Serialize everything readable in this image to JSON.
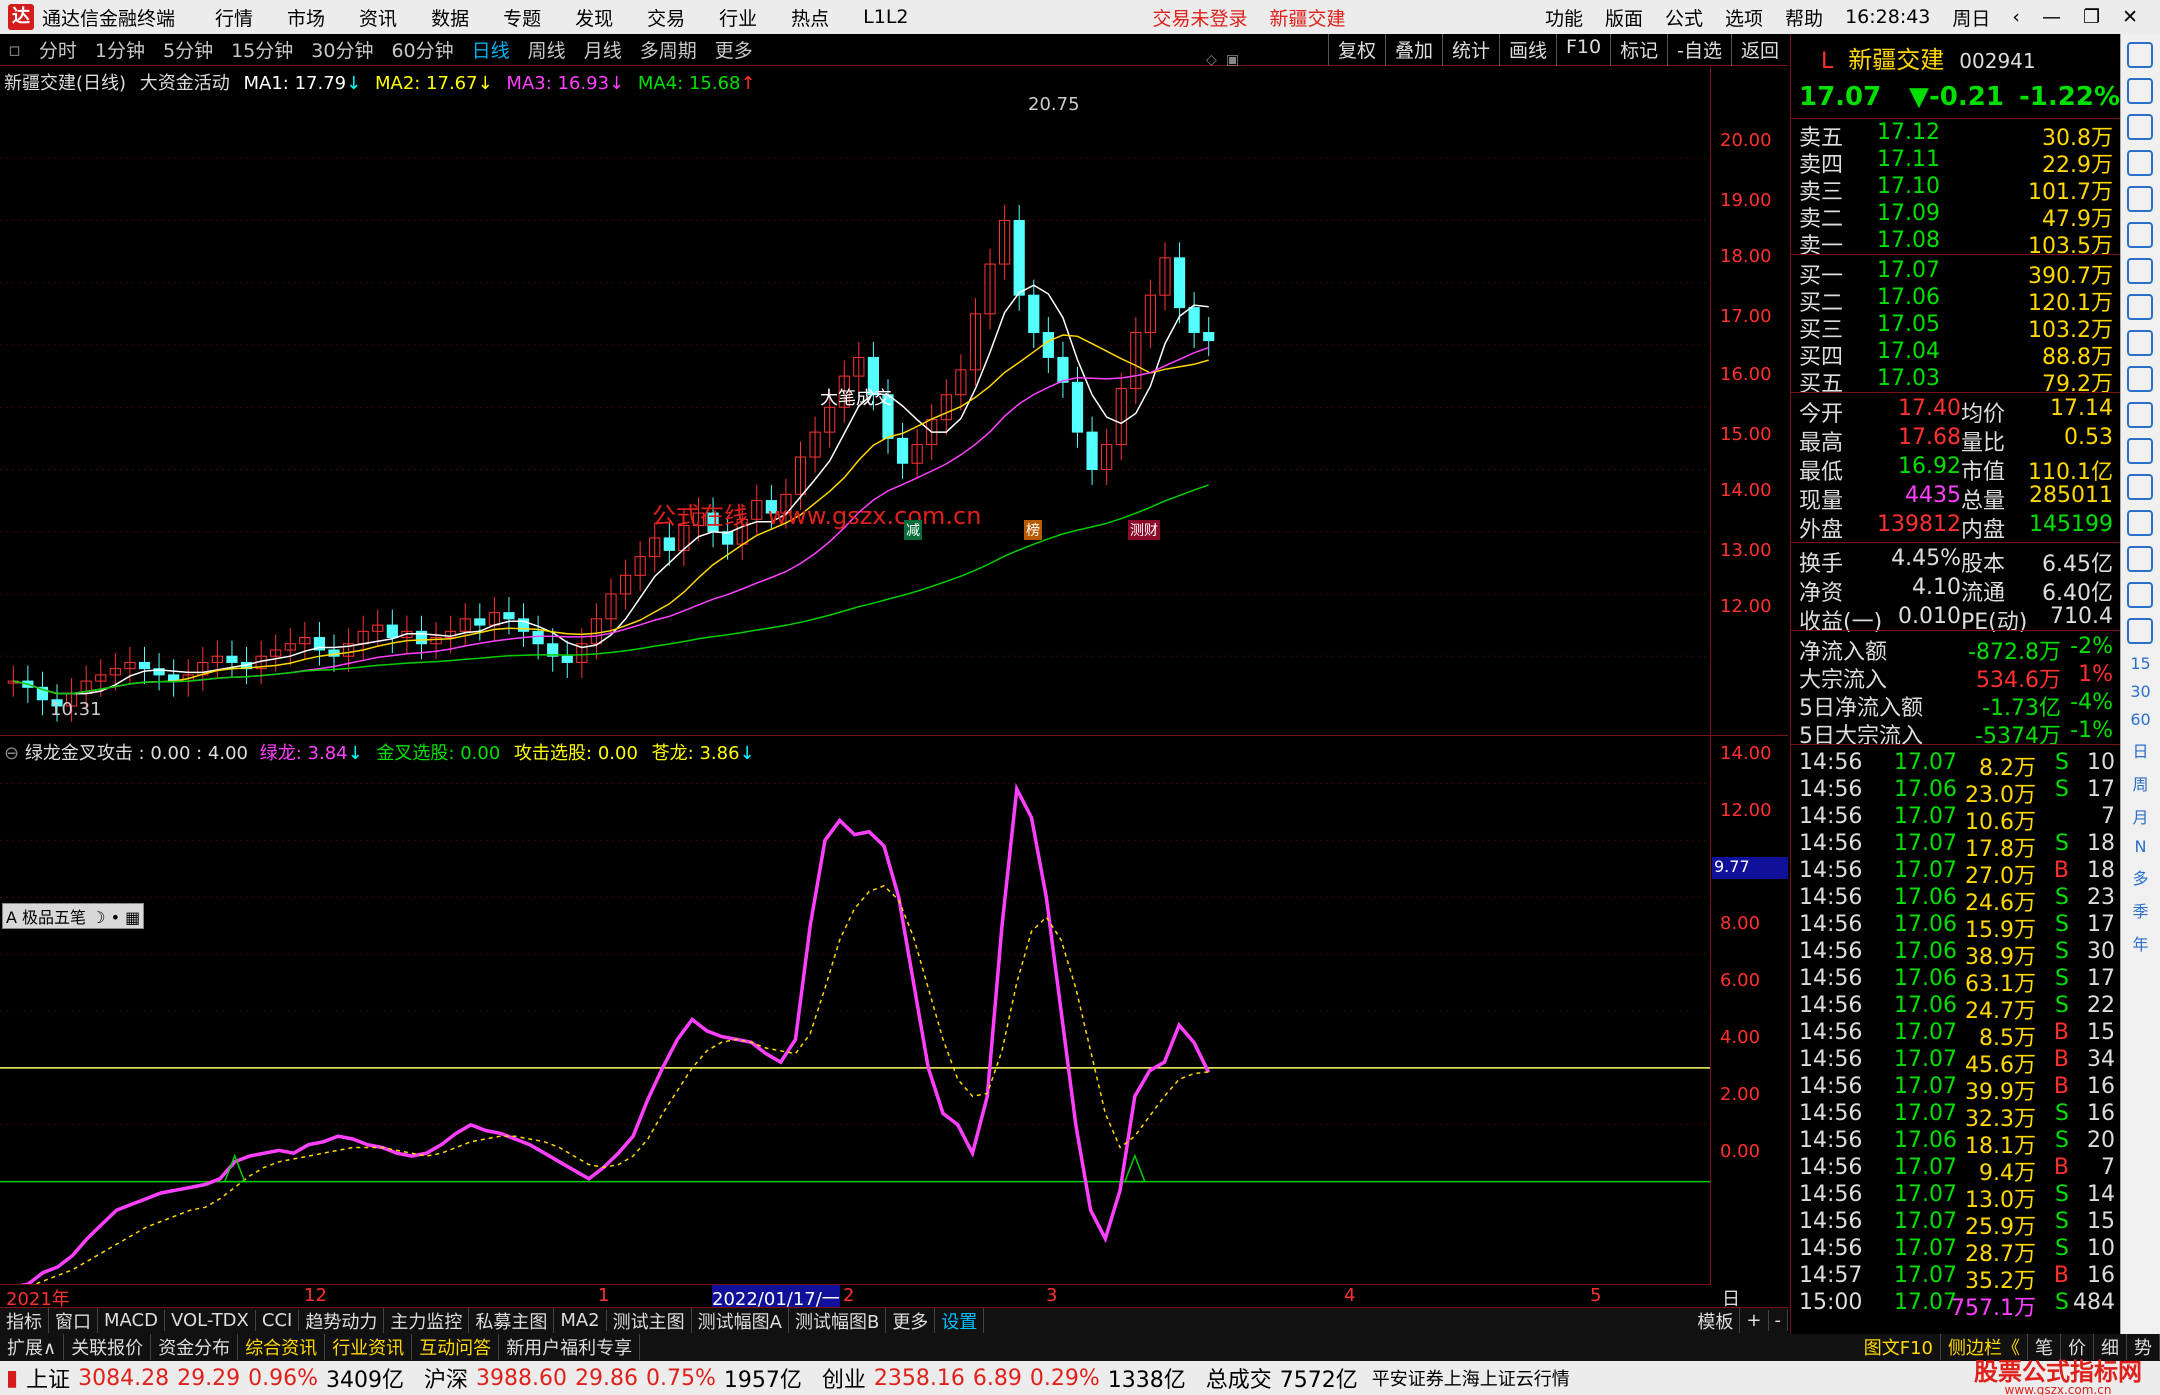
{
  "menubar": {
    "app_title": "通达信金融终端",
    "items": [
      "行情",
      "市场",
      "资讯",
      "数据",
      "专题",
      "发现",
      "交易",
      "行业",
      "热点",
      "L1L2"
    ],
    "warn1": "交易未登录",
    "warn2": "新疆交建",
    "right": [
      "功能",
      "版面",
      "公式",
      "选项",
      "帮助"
    ],
    "time": "16:28:43",
    "weekday": "周日"
  },
  "periods": [
    "分时",
    "1分钟",
    "5分钟",
    "15分钟",
    "30分钟",
    "60分钟",
    "日线",
    "周线",
    "月线",
    "多周期",
    "更多"
  ],
  "active_period": "日线",
  "toolbar_right": [
    "复权",
    "叠加",
    "统计",
    "画线",
    "F10",
    "标记",
    "-自选",
    "返回"
  ],
  "main_legend": {
    "name": "新疆交建(日线)",
    "indicator": "大资金活动",
    "ma1": "MA1: 17.79",
    "ma2": "MA2: 17.67",
    "ma3": "MA3: 16.93",
    "ma4": "MA4: 15.68"
  },
  "price_axis": [
    "20.00",
    "19.00",
    "18.00",
    "17.00",
    "16.00",
    "15.00",
    "14.00",
    "13.00",
    "12.00"
  ],
  "annotations": {
    "high": "20.75",
    "low": "10.31",
    "big_trade": "大笔成交",
    "watermark": "公式在线",
    "watermark_url": "www.gszx.com.cn",
    "mark1": "减",
    "mark2": "榜",
    "mark3": "测财"
  },
  "sub_legend": {
    "name": "绿龙金叉攻击 : 0.00 : 4.00",
    "green_dragon": "绿龙: 3.84",
    "golden_cross": "金叉选股: 0.00",
    "attack": "攻击选股: 0.00",
    "canglong": "苍龙: 3.86"
  },
  "sub_axis": [
    "14.00",
    "12.00",
    "10.00",
    "8.00",
    "6.00",
    "4.00",
    "2.00",
    "0.00"
  ],
  "sub_marker": "9.77",
  "five_pen": "极品五笔",
  "dates": [
    "2021年",
    "12",
    "1",
    "2022/01/17/一",
    "2",
    "3",
    "4",
    "5"
  ],
  "date_right": "日线",
  "tabs1": [
    "指标",
    "窗口",
    "MACD",
    "VOL-TDX",
    "CCI",
    "趋势动力",
    "主力监控",
    "私募主图",
    "MA2",
    "测试主图",
    "测试幅图A",
    "测试幅图B",
    "更多",
    "设置"
  ],
  "tabs1_right": [
    "模板",
    "+",
    "-"
  ],
  "tabs2": [
    "扩展∧",
    "关联报价",
    "资金分布",
    "综合资讯",
    "行业资讯",
    "互动问答",
    "新用户福利专享"
  ],
  "tabs2_right": [
    "图文F10",
    "侧边栏《",
    "笔",
    "价",
    "细",
    "势"
  ],
  "status": {
    "sh_name": "上证",
    "sh_val": "3084.28",
    "sh_chg": "29.29",
    "sh_pct": "0.96%",
    "sh_amt": "3409亿",
    "sz_name": "沪深",
    "sz_val": "3988.60",
    "sz_chg": "29.86",
    "sz_pct": "0.75%",
    "sz_amt": "1957亿",
    "cy_name": "创业",
    "cy_val": "2358.16",
    "cy_chg": "6.89",
    "cy_pct": "0.29%",
    "cy_amt": "1338亿",
    "total_label": "总成交",
    "total_val": "7572亿",
    "broker": "平安证券上海上证云行情",
    "brand": "股票公式指标网",
    "brand_url": "www.gszx.com.cn"
  },
  "quote": {
    "name": "新疆交建",
    "code": "002941",
    "price": "17.07",
    "change": "▼-0.21",
    "pct": "-1.22%",
    "asks": [
      {
        "label": "卖五",
        "price": "17.12",
        "vol": "30.8万"
      },
      {
        "label": "卖四",
        "price": "17.11",
        "vol": "22.9万"
      },
      {
        "label": "卖三",
        "price": "17.10",
        "vol": "101.7万"
      },
      {
        "label": "卖二",
        "price": "17.09",
        "vol": "47.9万"
      },
      {
        "label": "卖一",
        "price": "17.08",
        "vol": "103.5万"
      }
    ],
    "bids": [
      {
        "label": "买一",
        "price": "17.07",
        "vol": "390.7万"
      },
      {
        "label": "买二",
        "price": "17.06",
        "vol": "120.1万"
      },
      {
        "label": "买三",
        "price": "17.05",
        "vol": "103.2万"
      },
      {
        "label": "买四",
        "price": "17.04",
        "vol": "88.8万"
      },
      {
        "label": "买五",
        "price": "17.03",
        "vol": "79.2万"
      }
    ],
    "stats": [
      {
        "l1": "今开",
        "v1": "17.40",
        "l2": "均价",
        "v2": "17.14"
      },
      {
        "l1": "最高",
        "v1": "17.68",
        "l2": "量比",
        "v2": "0.53"
      },
      {
        "l1": "最低",
        "v1": "16.92",
        "l2": "市值",
        "v2": "110.1亿"
      },
      {
        "l1": "现量",
        "v1": "4435",
        "l2": "总量",
        "v2": "285011"
      },
      {
        "l1": "外盘",
        "v1": "139812",
        "l2": "内盘",
        "v2": "145199"
      }
    ],
    "stats2": [
      {
        "l1": "换手",
        "v1": "4.45%",
        "l2": "股本",
        "v2": "6.45亿"
      },
      {
        "l1": "净资",
        "v1": "4.10",
        "l2": "流通",
        "v2": "6.40亿"
      },
      {
        "l1": "收益(一)",
        "v1": "0.010",
        "l2": "PE(动)",
        "v2": "710.4"
      }
    ],
    "flows": [
      {
        "label": "净流入额",
        "val": "-872.8万",
        "pct": "-2%"
      },
      {
        "label": "大宗流入",
        "val": "534.6万",
        "pct": "1%"
      },
      {
        "label": "5日净流入额",
        "val": "-1.73亿",
        "pct": "-4%"
      },
      {
        "label": "5日大宗流入",
        "val": "-5374万",
        "pct": "-1%"
      }
    ],
    "ticks": [
      {
        "t": "14:56",
        "p": "17.07",
        "v": "8.2万",
        "d": "S",
        "n": "10"
      },
      {
        "t": "14:56",
        "p": "17.06",
        "v": "23.0万",
        "d": "S",
        "n": "17"
      },
      {
        "t": "14:56",
        "p": "17.07",
        "v": "10.6万",
        "d": "",
        "n": "7"
      },
      {
        "t": "14:56",
        "p": "17.07",
        "v": "17.8万",
        "d": "S",
        "n": "18"
      },
      {
        "t": "14:56",
        "p": "17.07",
        "v": "27.0万",
        "d": "B",
        "n": "18"
      },
      {
        "t": "14:56",
        "p": "17.06",
        "v": "24.6万",
        "d": "S",
        "n": "23"
      },
      {
        "t": "14:56",
        "p": "17.06",
        "v": "15.9万",
        "d": "S",
        "n": "17"
      },
      {
        "t": "14:56",
        "p": "17.06",
        "v": "38.9万",
        "d": "S",
        "n": "30"
      },
      {
        "t": "14:56",
        "p": "17.06",
        "v": "63.1万",
        "d": "S",
        "n": "17"
      },
      {
        "t": "14:56",
        "p": "17.06",
        "v": "24.7万",
        "d": "S",
        "n": "22"
      },
      {
        "t": "14:56",
        "p": "17.07",
        "v": "8.5万",
        "d": "B",
        "n": "15"
      },
      {
        "t": "14:56",
        "p": "17.07",
        "v": "45.6万",
        "d": "B",
        "n": "34"
      },
      {
        "t": "14:56",
        "p": "17.07",
        "v": "39.9万",
        "d": "B",
        "n": "16"
      },
      {
        "t": "14:56",
        "p": "17.07",
        "v": "32.3万",
        "d": "S",
        "n": "16"
      },
      {
        "t": "14:56",
        "p": "17.06",
        "v": "18.1万",
        "d": "S",
        "n": "20"
      },
      {
        "t": "14:56",
        "p": "17.07",
        "v": "9.4万",
        "d": "B",
        "n": "7"
      },
      {
        "t": "14:56",
        "p": "17.07",
        "v": "13.0万",
        "d": "S",
        "n": "14"
      },
      {
        "t": "14:56",
        "p": "17.07",
        "v": "25.9万",
        "d": "S",
        "n": "15"
      },
      {
        "t": "14:56",
        "p": "17.07",
        "v": "28.7万",
        "d": "S",
        "n": "10"
      },
      {
        "t": "14:57",
        "p": "17.07",
        "v": "35.2万",
        "d": "B",
        "n": "16"
      },
      {
        "t": "15:00",
        "p": "17.07",
        "v": "757.1万",
        "d": "S",
        "n": "484"
      }
    ]
  },
  "sidebar_icons": [
    "close-icon",
    "up-icon",
    "doc-icon",
    "chart-icon",
    "trend-icon",
    "candle-icon",
    "list-icon",
    "f10-icon",
    "news-icon",
    "f1-icon",
    "f2-icon",
    "circle-icon",
    "rsi-icon",
    "move-icon",
    "pen-icon",
    "fs-icon",
    "chart2-icon"
  ],
  "sidebar_labels": [
    "15",
    "30",
    "60",
    "日",
    "周",
    "月",
    "N",
    "多",
    "季",
    "年"
  ],
  "chart_data": [
    {
      "type": "candlestick",
      "title": "新疆交建(日线)",
      "ylim": [
        11.2,
        21.0
      ],
      "series_close": [
        11.6,
        11.5,
        11.3,
        11.2,
        11.4,
        11.6,
        11.7,
        11.8,
        11.9,
        11.8,
        11.7,
        11.6,
        11.7,
        11.9,
        12.0,
        11.9,
        11.8,
        12.0,
        12.1,
        12.2,
        12.3,
        12.1,
        12.0,
        12.2,
        12.4,
        12.5,
        12.3,
        12.4,
        12.2,
        12.3,
        12.4,
        12.6,
        12.5,
        12.7,
        12.6,
        12.4,
        12.2,
        12.0,
        11.9,
        12.2,
        12.6,
        13.0,
        13.3,
        13.6,
        13.9,
        13.7,
        14.1,
        14.3,
        14.0,
        13.8,
        14.2,
        14.5,
        14.3,
        14.6,
        15.2,
        15.6,
        16.0,
        16.5,
        16.8,
        16.2,
        15.5,
        15.1,
        15.4,
        15.8,
        16.2,
        16.6,
        17.5,
        18.3,
        19.0,
        17.8,
        17.2,
        16.8,
        16.4,
        15.6,
        15.0,
        15.4,
        16.3,
        17.2,
        17.8,
        18.4,
        17.6,
        17.2,
        17.07
      ],
      "ma_values": {
        "MA1": 17.79,
        "MA2": 17.67,
        "MA3": 16.93,
        "MA4": 15.68
      }
    },
    {
      "type": "line",
      "title": "绿龙金叉攻击",
      "ylim": [
        -3,
        15
      ],
      "series": [
        {
          "name": "绿龙",
          "values": [
            -3.7,
            -3.6,
            -3.2,
            -3.0,
            -2.6,
            -2.0,
            -1.5,
            -1.0,
            -0.8,
            -0.6,
            -0.4,
            -0.3,
            -0.2,
            -0.1,
            0.1,
            0.7,
            0.9,
            1.0,
            1.1,
            1.0,
            1.3,
            1.4,
            1.6,
            1.5,
            1.3,
            1.2,
            1.0,
            0.9,
            1.0,
            1.3,
            1.7,
            2.0,
            1.8,
            1.7,
            1.5,
            1.3,
            1.0,
            0.7,
            0.4,
            0.1,
            0.5,
            1.0,
            1.6,
            2.9,
            4.0,
            5.0,
            5.7,
            5.3,
            5.1,
            5.0,
            4.9,
            4.5,
            4.2,
            5.0,
            9.0,
            12.0,
            12.7,
            12.2,
            12.3,
            11.8,
            10.0,
            7.0,
            4.0,
            2.4,
            2.0,
            1.0,
            3.0,
            9.0,
            13.8,
            12.8,
            10.0,
            6.0,
            2.0,
            -1.0,
            -2.0,
            -0.3,
            3.0,
            3.9,
            4.2,
            5.5,
            4.9,
            3.84
          ]
        },
        {
          "name": "苍龙",
          "values": [
            -3.8,
            -3.7,
            -3.5,
            -3.3,
            -3.1,
            -2.8,
            -2.5,
            -2.2,
            -1.9,
            -1.6,
            -1.4,
            -1.2,
            -1.0,
            -0.9,
            -0.6,
            -0.2,
            0.2,
            0.5,
            0.7,
            0.8,
            0.9,
            1.0,
            1.1,
            1.2,
            1.2,
            1.2,
            1.1,
            1.0,
            0.9,
            1.0,
            1.2,
            1.4,
            1.5,
            1.6,
            1.6,
            1.5,
            1.4,
            1.2,
            0.9,
            0.6,
            0.5,
            0.6,
            0.9,
            1.5,
            2.4,
            3.2,
            4.0,
            4.6,
            4.9,
            5.0,
            4.9,
            4.7,
            4.6,
            4.5,
            5.2,
            6.8,
            8.5,
            9.6,
            10.2,
            10.4,
            9.9,
            8.6,
            6.8,
            5.0,
            3.6,
            3.0,
            3.1,
            4.6,
            7.0,
            8.8,
            9.3,
            8.5,
            6.8,
            4.6,
            2.4,
            1.2,
            1.6,
            2.3,
            3.0,
            3.6,
            3.8,
            3.86
          ]
        }
      ],
      "reference_lines": [
        4.0,
        0.0
      ]
    }
  ]
}
